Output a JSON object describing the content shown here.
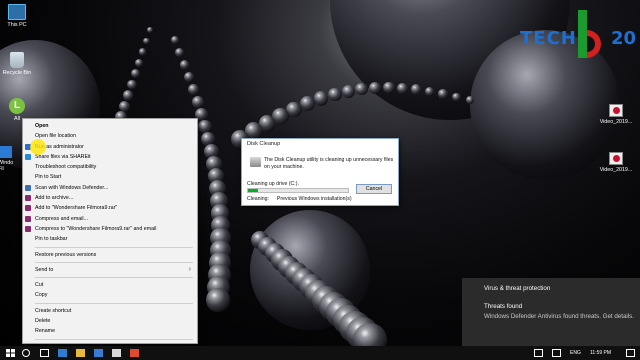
{
  "desktop": {
    "icons": [
      {
        "label": "This PC",
        "icon": "computer-icon"
      },
      {
        "label": "Recycle Bin",
        "icon": "recycle-bin-icon"
      },
      {
        "label": "All",
        "icon": "app-icon"
      },
      {
        "label": "Windo Fil",
        "icon": "filmora-icon"
      }
    ],
    "right_icons": [
      {
        "label": "Video_2019...",
        "icon": "video-file-icon"
      },
      {
        "label": "Video_2019...",
        "icon": "video-file-icon"
      }
    ]
  },
  "logo": {
    "part1": "TECH",
    "part2": "20",
    "colors": {
      "blue": "#1d6fd1",
      "green": "#1b9a2f",
      "red": "#d0201f"
    }
  },
  "context_menu": {
    "items": [
      {
        "label": "Open",
        "bold": true
      },
      {
        "label": "Open file location"
      },
      {
        "label": "Run as administrator",
        "icon": "shield-icon"
      },
      {
        "label": "Share files via SHAREit",
        "icon": "shareit-icon"
      },
      {
        "label": "Troubleshoot compatibility"
      },
      {
        "label": "Pin to Start"
      },
      {
        "label": "Scan with Windows Defender...",
        "icon": "defender-icon"
      },
      {
        "label": "Add to archive...",
        "icon": "winrar-icon"
      },
      {
        "label": "Add to \"Wondershare Filmora9.rar\"",
        "icon": "winrar-icon"
      },
      {
        "label": "Compress and email...",
        "icon": "winrar-icon"
      },
      {
        "label": "Compress to \"Wondershare Filmora9.rar\" and email",
        "icon": "winrar-icon"
      },
      {
        "label": "Pin to taskbar"
      },
      {
        "separator": true
      },
      {
        "label": "Restore previous versions"
      },
      {
        "separator": true
      },
      {
        "label": "Send to",
        "submenu": true
      },
      {
        "separator": true
      },
      {
        "label": "Cut"
      },
      {
        "label": "Copy"
      },
      {
        "separator": true
      },
      {
        "label": "Create shortcut"
      },
      {
        "label": "Delete"
      },
      {
        "label": "Rename"
      },
      {
        "separator": true
      },
      {
        "label": "Properties"
      }
    ]
  },
  "disk_cleanup": {
    "title": "Disk Cleanup",
    "message": "The Disk Cleanup utility is cleaning up unnecessary files on your machine.",
    "status": "Cleaning up drive  (C:).",
    "progress": 0.1,
    "cancel_label": "Cancel",
    "cleaning_label": "Cleaning:",
    "cleaning_item": "Previous Windows installation(s)"
  },
  "toast": {
    "header": "Virus & threat protection",
    "title": "Threats found",
    "body": "Windows Defender Antivirus found threats. Get details."
  },
  "taskbar": {
    "language": "ENG",
    "time": "11:59 PM"
  }
}
